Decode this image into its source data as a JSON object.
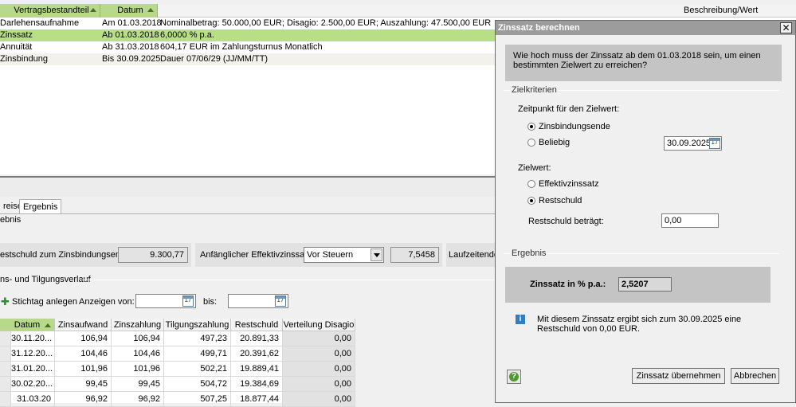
{
  "top_table": {
    "headers": {
      "component": "Vertragsbestandteil",
      "date": "Datum",
      "description": "Beschreibung/Wert"
    },
    "rows": [
      {
        "component": "Darlehensaufnahme",
        "date": "Am 01.03.2018",
        "value": "Nominalbetrag: 50.000,00 EUR; Disagio: 2.500,00 EUR; Auszahlung: 47.500,00 EUR"
      },
      {
        "component": "Zinssatz",
        "date": "Ab 01.03.2018",
        "value": "6,0000 % p.a."
      },
      {
        "component": "Annuität",
        "date": "Ab 31.03.2018",
        "value": "604,17 EUR im Zahlungsturnus Monatlich"
      },
      {
        "component": "Zinsbindung",
        "date": "Bis 30.09.2025",
        "value": "Dauer 07/06/29 (JJ/MM/TT)"
      }
    ]
  },
  "tabs": {
    "prev": "reise",
    "active": "Ergebnis"
  },
  "panel": {
    "heading": "ebnis",
    "restschuld_label": "estschuld zum Zinsbindungsende:",
    "restschuld_value": "9.300,77",
    "effektiv_label": "Anfänglicher Effektivzinssatz:",
    "effektiv_select": "Vor Steuern",
    "effektiv_value": "7,5458",
    "laufzeit_label": "Laufzeitende:",
    "verlauf_title": "ns- und Tilgungsverlauf",
    "stichtag_button": "Stichtag anlegen",
    "anzeigen_label": "Anzeigen von:",
    "bis_label": "bis:",
    "cal_glyph": "17"
  },
  "grid": {
    "headers": [
      "Datum",
      "Zinsaufwand",
      "Zinszahlung",
      "Tilgungszahlung",
      "Restschuld",
      "Verteilung Disagio"
    ],
    "rows": [
      [
        "30.11.20...",
        "106,94",
        "106,94",
        "497,23",
        "20.891,33",
        "0,00"
      ],
      [
        "31.12.20...",
        "104,46",
        "104,46",
        "499,71",
        "20.391,62",
        "0,00"
      ],
      [
        "31.01.20...",
        "101,96",
        "101,96",
        "502,21",
        "19.889,41",
        "0,00"
      ],
      [
        "30.02.20...",
        "99,45",
        "99,45",
        "504,72",
        "19.384,69",
        "0,00"
      ],
      [
        "31.03.20",
        "96,92",
        "96,92",
        "507,25",
        "18.877,44",
        "0,00"
      ]
    ]
  },
  "dialog": {
    "title": "Zinssatz berechnen",
    "close": "✕",
    "question": "Wie hoch muss der Zinssatz ab dem 01.03.2018 sein, um einen bestimmten Zielwert zu erreichen?",
    "zielkriterien_label": "Zielkriterien",
    "zeitpunkt_label": "Zeitpunkt für den Zielwert:",
    "opt_zinsbindungsende": "Zinsbindungsende",
    "opt_beliebig": "Beliebig",
    "date_value": "30.09.2025",
    "zielwert_label": "Zielwert:",
    "opt_effektivzinssatz": "Effektivzinssatz",
    "opt_restschuld": "Restschuld",
    "restschuld_betraegt_label": "Restschuld beträgt:",
    "restschuld_betraegt_value": "0,00",
    "ergebnis_label": "Ergebnis",
    "result_label": "Zinssatz in % p.a.:",
    "result_value": "2,5207",
    "info_text": "Mit diesem Zinssatz ergibt sich zum 30.09.2025 eine Restschuld von 0,00 EUR.",
    "info_icon": "i",
    "help_icon": "?",
    "apply_button": "Zinssatz übernehmen",
    "cancel_button": "Abbrechen"
  }
}
